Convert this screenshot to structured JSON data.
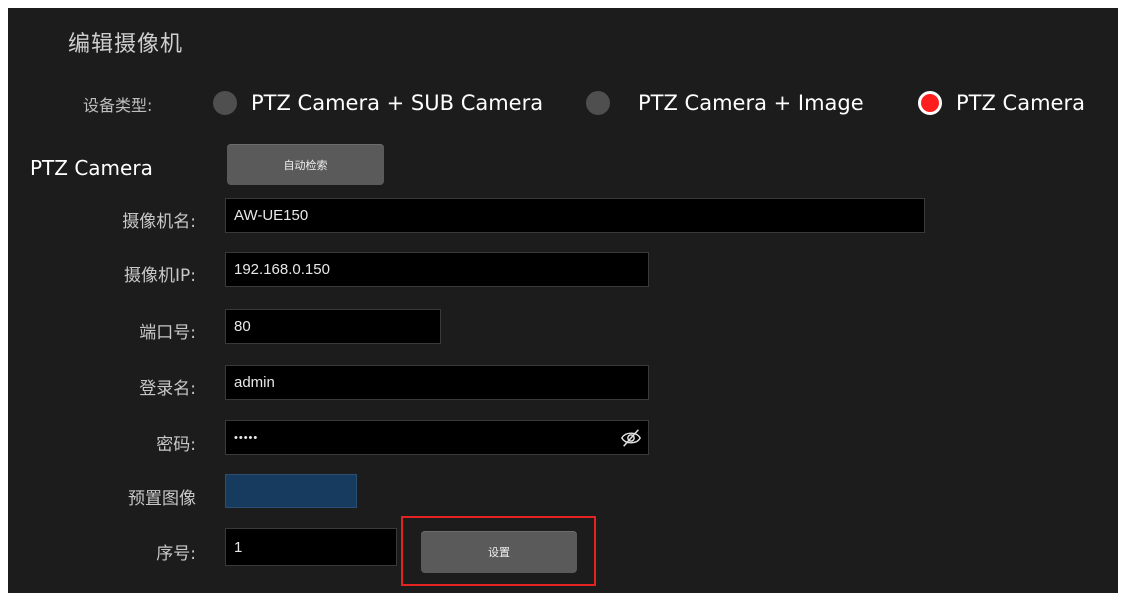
{
  "dialog": {
    "title": "编辑摄像机",
    "device_type_label": "设备类型:",
    "device_types": [
      {
        "label": "PTZ Camera + SUB Camera",
        "selected": false
      },
      {
        "label": "PTZ Camera + Image",
        "selected": false
      },
      {
        "label": "PTZ Camera",
        "selected": true
      }
    ],
    "section_label": "PTZ Camera",
    "auto_search_label": "自动检索",
    "fields": {
      "camera_name": {
        "label": "摄像机名:",
        "value": "AW-UE150"
      },
      "camera_ip": {
        "label": "摄像机IP:",
        "value": "192.168.0.150"
      },
      "port": {
        "label": "端口号:",
        "value": "80"
      },
      "login_name": {
        "label": "登录名:",
        "value": "admin"
      },
      "password": {
        "label": "密码:",
        "value": "•••••"
      },
      "preset_image": {
        "label": "预置图像"
      },
      "serial_no": {
        "label": "序号:",
        "value": "1"
      }
    },
    "set_button_label": "设置",
    "colors": {
      "panel_bg": "#1c1c1c",
      "selected_radio": "#ff1e1e",
      "preset_swatch": "#163b5e",
      "highlight_box": "#e32222"
    },
    "icons": {
      "password_toggle": "eye-slash-icon"
    }
  }
}
